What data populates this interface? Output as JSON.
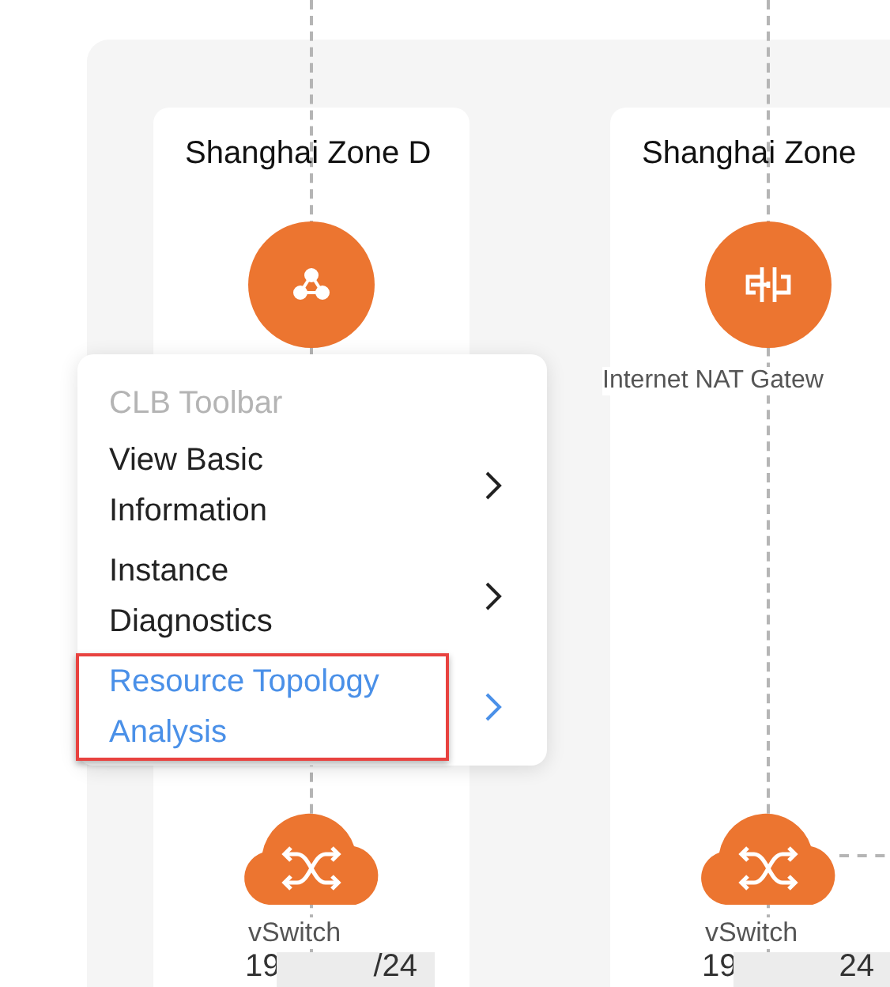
{
  "zones": [
    {
      "title": "Shanghai Zone D",
      "node": {
        "kind": "clb"
      },
      "vswitch": {
        "name": "vSwitch",
        "ip_start": "19",
        "ip_end": "/24"
      }
    },
    {
      "title": "Shanghai Zone",
      "node": {
        "kind": "nat",
        "label": "Internet NAT Gatew"
      },
      "vswitch": {
        "name": "vSwitch",
        "ip_start": "19",
        "ip_end": "24"
      }
    }
  ],
  "menu": {
    "title": "CLB Toolbar",
    "items": [
      {
        "label": "View Basic Information",
        "selected": false,
        "annotated": false
      },
      {
        "label": "Instance Diagnostics",
        "selected": false,
        "annotated": false
      },
      {
        "label": "Resource Topology Analysis",
        "selected": true,
        "annotated": true
      }
    ]
  }
}
